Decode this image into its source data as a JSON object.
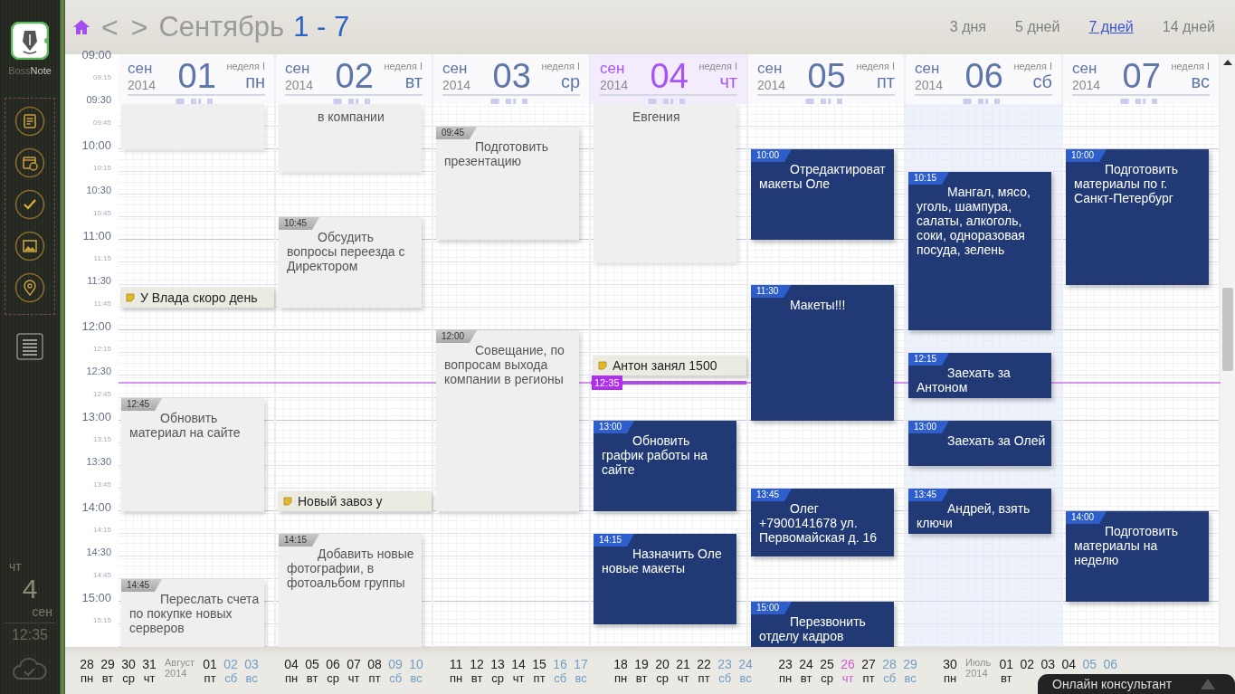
{
  "sidebar": {
    "brand": [
      "Boss",
      "Note"
    ],
    "today": {
      "weekday": "чт",
      "day": "4",
      "month": "сен"
    },
    "time": "12:35"
  },
  "header": {
    "prev": "<",
    "next": ">",
    "month": "Сентябрь",
    "range": "1 - 7",
    "views": [
      {
        "label": "3 дня",
        "selected": false
      },
      {
        "label": "5 дней",
        "selected": false
      },
      {
        "label": "7 дней",
        "selected": true
      },
      {
        "label": "14 дней",
        "selected": false
      }
    ]
  },
  "times": [
    "09:00",
    "09:15",
    "09:30",
    "09:45",
    "10:00",
    "10:15",
    "10:30",
    "10:45",
    "11:00",
    "11:15",
    "11:30",
    "11:45",
    "12:00",
    "12:15",
    "12:30",
    "12:45",
    "13:00",
    "13:15",
    "13:30",
    "13:45",
    "14:00",
    "14:15",
    "14:30",
    "14:45",
    "15:00",
    "15:15"
  ],
  "days": [
    {
      "month": "сен",
      "year": "2014",
      "date": "01",
      "weekday": "пн",
      "week": "неделя I",
      "today": false,
      "shaded": false,
      "blocks": [
        {
          "kind": "hidden",
          "quarters": [
            true,
            true
          ]
        },
        {
          "kind": "gap",
          "quarters": [
            true,
            true,
            true,
            true,
            true,
            true
          ]
        },
        {
          "kind": "note",
          "quarters": [
            true
          ],
          "text": "У Влада скоро день"
        },
        {
          "kind": "gap",
          "quarters": [
            true,
            true,
            true,
            true
          ]
        },
        {
          "kind": "past",
          "quarters": [
            true,
            true,
            true,
            true,
            true
          ],
          "time": "12:45",
          "text": "Обновить материал на сайте"
        },
        {
          "kind": "gap",
          "quarters": [
            true,
            true,
            true
          ]
        },
        {
          "kind": "past",
          "quarters": [
            true,
            true,
            true
          ],
          "time": "14:45",
          "text": "Переслать счета по покупке новых серверов"
        }
      ]
    },
    {
      "month": "сен",
      "year": "2014",
      "date": "02",
      "weekday": "вт",
      "week": "неделя I",
      "today": false,
      "shaded": false,
      "blocks": [
        {
          "kind": "hidden",
          "quarters": [
            true,
            true,
            true
          ],
          "text": "в компании"
        },
        {
          "kind": "gap",
          "quarters": [
            true,
            true
          ]
        },
        {
          "kind": "past",
          "quarters": [
            true,
            true,
            true,
            true
          ],
          "time": "10:45",
          "text": "Обсудить вопросы переезда с Директором"
        },
        {
          "kind": "gap",
          "quarters": [
            true,
            true,
            true,
            true,
            true,
            true,
            true,
            true
          ]
        },
        {
          "kind": "note",
          "quarters": [
            true
          ],
          "text": "Новый завоз у"
        },
        {
          "kind": "gap",
          "quarters": [
            true
          ]
        },
        {
          "kind": "past",
          "quarters": [
            true,
            true,
            true,
            true,
            true
          ],
          "time": "14:15",
          "text": "Добавить новые фотографии, в фотоальбом группы"
        }
      ]
    },
    {
      "month": "сен",
      "year": "2014",
      "date": "03",
      "weekday": "ср",
      "week": "неделя I",
      "today": false,
      "shaded": false,
      "blocks": [
        {
          "kind": "gap",
          "quarters": [
            true
          ]
        },
        {
          "kind": "past",
          "quarters": [
            true,
            true,
            true,
            true,
            true
          ],
          "time": "09:45",
          "text": "Подготовить презентацию"
        },
        {
          "kind": "gap",
          "quarters": [
            true,
            true,
            true,
            true
          ]
        },
        {
          "kind": "past",
          "quarters": [
            true,
            true,
            true,
            true,
            true,
            true,
            true,
            true
          ],
          "time": "12:00",
          "text": "Совещание, по вопросам выхода компании в регионы"
        }
      ]
    },
    {
      "month": "сен",
      "year": "2014",
      "date": "04",
      "weekday": "чт",
      "week": "неделя I",
      "today": true,
      "shaded": false,
      "blocks": [
        {
          "kind": "hidden",
          "quarters": [
            true,
            true,
            true,
            true,
            true,
            true,
            true
          ],
          "text": "Евгения"
        },
        {
          "kind": "gap",
          "quarters": [
            true,
            true,
            true,
            true
          ]
        },
        {
          "kind": "note",
          "quarters": [
            true
          ],
          "text": "Антон занял 1500"
        },
        {
          "kind": "gap",
          "quarters": [
            true,
            true
          ],
          "now": "12:35"
        },
        {
          "kind": "future",
          "quarters": [
            true,
            true,
            true,
            true
          ],
          "time": "13:00",
          "text": "Обновить график работы на сайте"
        },
        {
          "kind": "gap",
          "quarters": [
            true
          ]
        },
        {
          "kind": "future",
          "quarters": [
            true,
            true,
            true,
            true
          ],
          "time": "14:15",
          "text": "Назначить Оле новые макеты"
        }
      ]
    },
    {
      "month": "сен",
      "year": "2014",
      "date": "05",
      "weekday": "пт",
      "week": "неделя I",
      "today": false,
      "shaded": false,
      "blocks": [
        {
          "kind": "gap",
          "quarters": [
            true,
            true
          ]
        },
        {
          "kind": "future",
          "quarters": [
            true,
            true,
            true,
            true
          ],
          "time": "10:00",
          "text": "Отредактироват макеты Оле"
        },
        {
          "kind": "gap",
          "quarters": [
            true,
            true
          ]
        },
        {
          "kind": "future",
          "quarters": [
            true,
            true,
            true,
            true,
            true,
            true
          ],
          "time": "11:30",
          "text": "Макеты!!!"
        },
        {
          "kind": "gap",
          "quarters": [
            true,
            true,
            true
          ]
        },
        {
          "kind": "future",
          "quarters": [
            true,
            true,
            true
          ],
          "time": "13:45",
          "text": "Олег +7900141678 ул. Первомайская д. 16"
        },
        {
          "kind": "gap",
          "quarters": [
            true,
            true
          ]
        },
        {
          "kind": "future",
          "quarters": [
            true,
            true
          ],
          "time": "15:00",
          "text": "Перезвонить отделу кадров"
        }
      ]
    },
    {
      "month": "сен",
      "year": "2014",
      "date": "06",
      "weekday": "сб",
      "week": "неделя I",
      "today": false,
      "shaded": true,
      "blocks": [
        {
          "kind": "gap",
          "quarters": [
            true,
            true,
            true
          ]
        },
        {
          "kind": "future",
          "quarters": [
            true,
            true,
            true,
            true,
            true,
            true,
            true
          ],
          "time": "10:15",
          "text": "Мангал, мясо, уголь, шампура, салаты, алкоголь, соки, одноразовая посуда, зелень"
        },
        {
          "kind": "gap",
          "quarters": [
            true
          ]
        },
        {
          "kind": "future",
          "quarters": [
            true,
            true
          ],
          "time": "12:15",
          "text": "Заехать за Антоном"
        },
        {
          "kind": "gap",
          "quarters": [
            true
          ]
        },
        {
          "kind": "future",
          "quarters": [
            true,
            true
          ],
          "time": "13:00",
          "text": "Заехать за Олей"
        },
        {
          "kind": "gap",
          "quarters": [
            true
          ]
        },
        {
          "kind": "future",
          "quarters": [
            true,
            true
          ],
          "time": "13:45",
          "text": "Андрей, взять ключи"
        }
      ]
    },
    {
      "month": "сен",
      "year": "2014",
      "date": "07",
      "weekday": "вс",
      "week": "неделя I",
      "today": false,
      "shaded": false,
      "blocks": [
        {
          "kind": "gap",
          "quarters": [
            true,
            true
          ]
        },
        {
          "kind": "future",
          "quarters": [
            true,
            true,
            true,
            true,
            true,
            true
          ],
          "time": "10:00",
          "text": "Подготовить материалы по г. Санкт-Петербург"
        },
        {
          "kind": "gap",
          "quarters": [
            true,
            true,
            true,
            true,
            true,
            true,
            true,
            true,
            true,
            true
          ]
        },
        {
          "kind": "future",
          "quarters": [
            true,
            true,
            true,
            true
          ],
          "time": "14:00",
          "text": "Подготовить материалы на неделю"
        }
      ]
    }
  ],
  "mini_calendar": [
    [
      {
        "kind": "day",
        "date": "28",
        "weekday": "пн",
        "weekend": false,
        "today": false
      },
      {
        "kind": "day",
        "date": "29",
        "weekday": "вт",
        "weekend": false,
        "today": false
      },
      {
        "kind": "day",
        "date": "30",
        "weekday": "ср",
        "weekend": false,
        "today": false
      },
      {
        "kind": "day",
        "date": "31",
        "weekday": "чт",
        "weekend": false,
        "today": false
      },
      {
        "kind": "month",
        "name": "Август",
        "year": "2014"
      },
      {
        "kind": "day",
        "date": "01",
        "weekday": "пт",
        "weekend": false,
        "today": false
      },
      {
        "kind": "day",
        "date": "02",
        "weekday": "сб",
        "weekend": true,
        "today": false
      },
      {
        "kind": "day",
        "date": "03",
        "weekday": "вс",
        "weekend": true,
        "today": false
      }
    ],
    [
      {
        "kind": "day",
        "date": "04",
        "weekday": "пн",
        "weekend": false,
        "today": false
      },
      {
        "kind": "day",
        "date": "05",
        "weekday": "вт",
        "weekend": false,
        "today": false
      },
      {
        "kind": "day",
        "date": "06",
        "weekday": "ср",
        "weekend": false,
        "today": false
      },
      {
        "kind": "day",
        "date": "07",
        "weekday": "чт",
        "weekend": false,
        "today": false
      },
      {
        "kind": "day",
        "date": "08",
        "weekday": "пт",
        "weekend": false,
        "today": false
      },
      {
        "kind": "day",
        "date": "09",
        "weekday": "сб",
        "weekend": true,
        "today": false
      },
      {
        "kind": "day",
        "date": "10",
        "weekday": "вс",
        "weekend": true,
        "today": false
      }
    ],
    [
      {
        "kind": "day",
        "date": "11",
        "weekday": "пн",
        "weekend": false,
        "today": false
      },
      {
        "kind": "day",
        "date": "12",
        "weekday": "вт",
        "weekend": false,
        "today": false
      },
      {
        "kind": "day",
        "date": "13",
        "weekday": "ср",
        "weekend": false,
        "today": false
      },
      {
        "kind": "day",
        "date": "14",
        "weekday": "чт",
        "weekend": false,
        "today": false
      },
      {
        "kind": "day",
        "date": "15",
        "weekday": "пт",
        "weekend": false,
        "today": false
      },
      {
        "kind": "day",
        "date": "16",
        "weekday": "сб",
        "weekend": true,
        "today": false
      },
      {
        "kind": "day",
        "date": "17",
        "weekday": "вс",
        "weekend": true,
        "today": false
      }
    ],
    [
      {
        "kind": "day",
        "date": "18",
        "weekday": "пн",
        "weekend": false,
        "today": false
      },
      {
        "kind": "day",
        "date": "19",
        "weekday": "вт",
        "weekend": false,
        "today": false
      },
      {
        "kind": "day",
        "date": "20",
        "weekday": "ср",
        "weekend": false,
        "today": false
      },
      {
        "kind": "day",
        "date": "21",
        "weekday": "чт",
        "weekend": false,
        "today": false
      },
      {
        "kind": "day",
        "date": "22",
        "weekday": "пт",
        "weekend": false,
        "today": false
      },
      {
        "kind": "day",
        "date": "23",
        "weekday": "сб",
        "weekend": true,
        "today": false
      },
      {
        "kind": "day",
        "date": "24",
        "weekday": "вс",
        "weekend": true,
        "today": false
      }
    ],
    [
      {
        "kind": "day",
        "date": "23",
        "weekday": "пн",
        "weekend": false,
        "today": false
      },
      {
        "kind": "day",
        "date": "24",
        "weekday": "вт",
        "weekend": false,
        "today": false
      },
      {
        "kind": "day",
        "date": "25",
        "weekday": "ср",
        "weekend": false,
        "today": false
      },
      {
        "kind": "day",
        "date": "26",
        "weekday": "чт",
        "weekend": false,
        "today": true
      },
      {
        "kind": "day",
        "date": "27",
        "weekday": "пт",
        "weekend": false,
        "today": false
      },
      {
        "kind": "day",
        "date": "28",
        "weekday": "сб",
        "weekend": true,
        "today": false
      },
      {
        "kind": "day",
        "date": "29",
        "weekday": "вс",
        "weekend": true,
        "today": false
      }
    ],
    [
      {
        "kind": "day",
        "date": "30",
        "weekday": "пн",
        "weekend": false,
        "today": false
      },
      {
        "kind": "month",
        "name": "Июль",
        "year": "2014"
      },
      {
        "kind": "day",
        "date": "01",
        "weekday": "вт",
        "weekend": false,
        "today": false
      },
      {
        "kind": "day",
        "date": "02",
        "weekend": false,
        "today": false
      },
      {
        "kind": "day",
        "date": "03",
        "weekend": false,
        "today": false
      },
      {
        "kind": "day",
        "date": "04",
        "weekend": false,
        "today": false
      },
      {
        "kind": "day",
        "date": "05",
        "weekend": true,
        "today": false
      },
      {
        "kind": "day",
        "date": "06",
        "weekend": true,
        "today": false
      }
    ]
  ],
  "chat": {
    "label": "Онлайн консультант"
  }
}
